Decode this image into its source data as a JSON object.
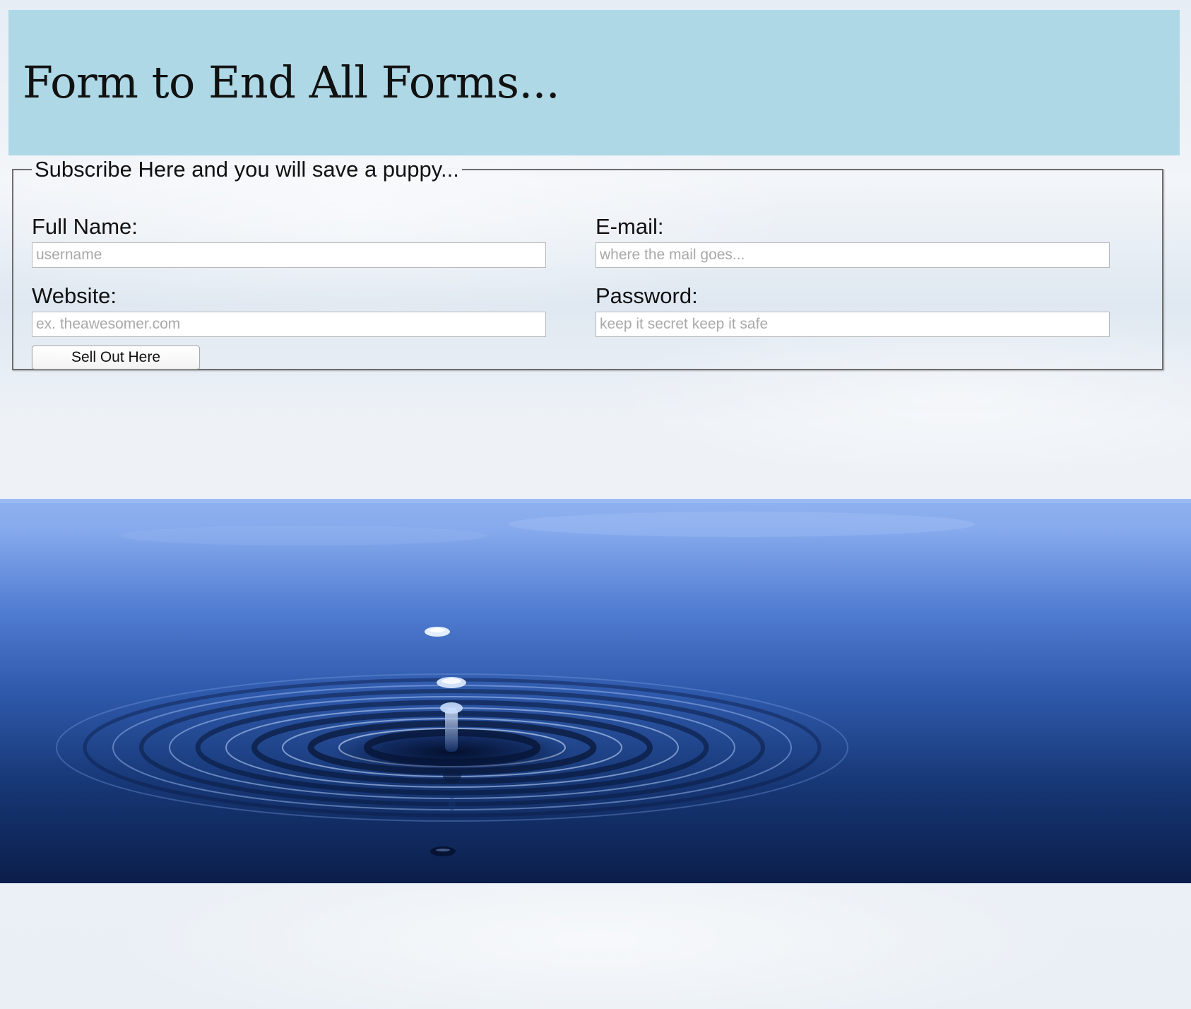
{
  "header": {
    "title": "Form to End All Forms..."
  },
  "form": {
    "legend": "Subscribe Here and you will save a puppy...",
    "fields": {
      "full_name": {
        "label": "Full Name:",
        "placeholder": "username",
        "value": ""
      },
      "email": {
        "label": "E-mail:",
        "placeholder": "where the mail goes...",
        "value": ""
      },
      "website": {
        "label": "Website:",
        "placeholder": "ex. theawesomer.com",
        "value": ""
      },
      "password": {
        "label": "Password:",
        "placeholder": "keep it secret keep it safe",
        "value": ""
      }
    },
    "submit_label": "Sell Out Here"
  },
  "colors": {
    "header_bg": "#aed8e6",
    "water_top": "#8fb1f0",
    "water_bottom": "#0b1e4a"
  },
  "banner": {
    "image": "water-drop-ripple-image"
  }
}
